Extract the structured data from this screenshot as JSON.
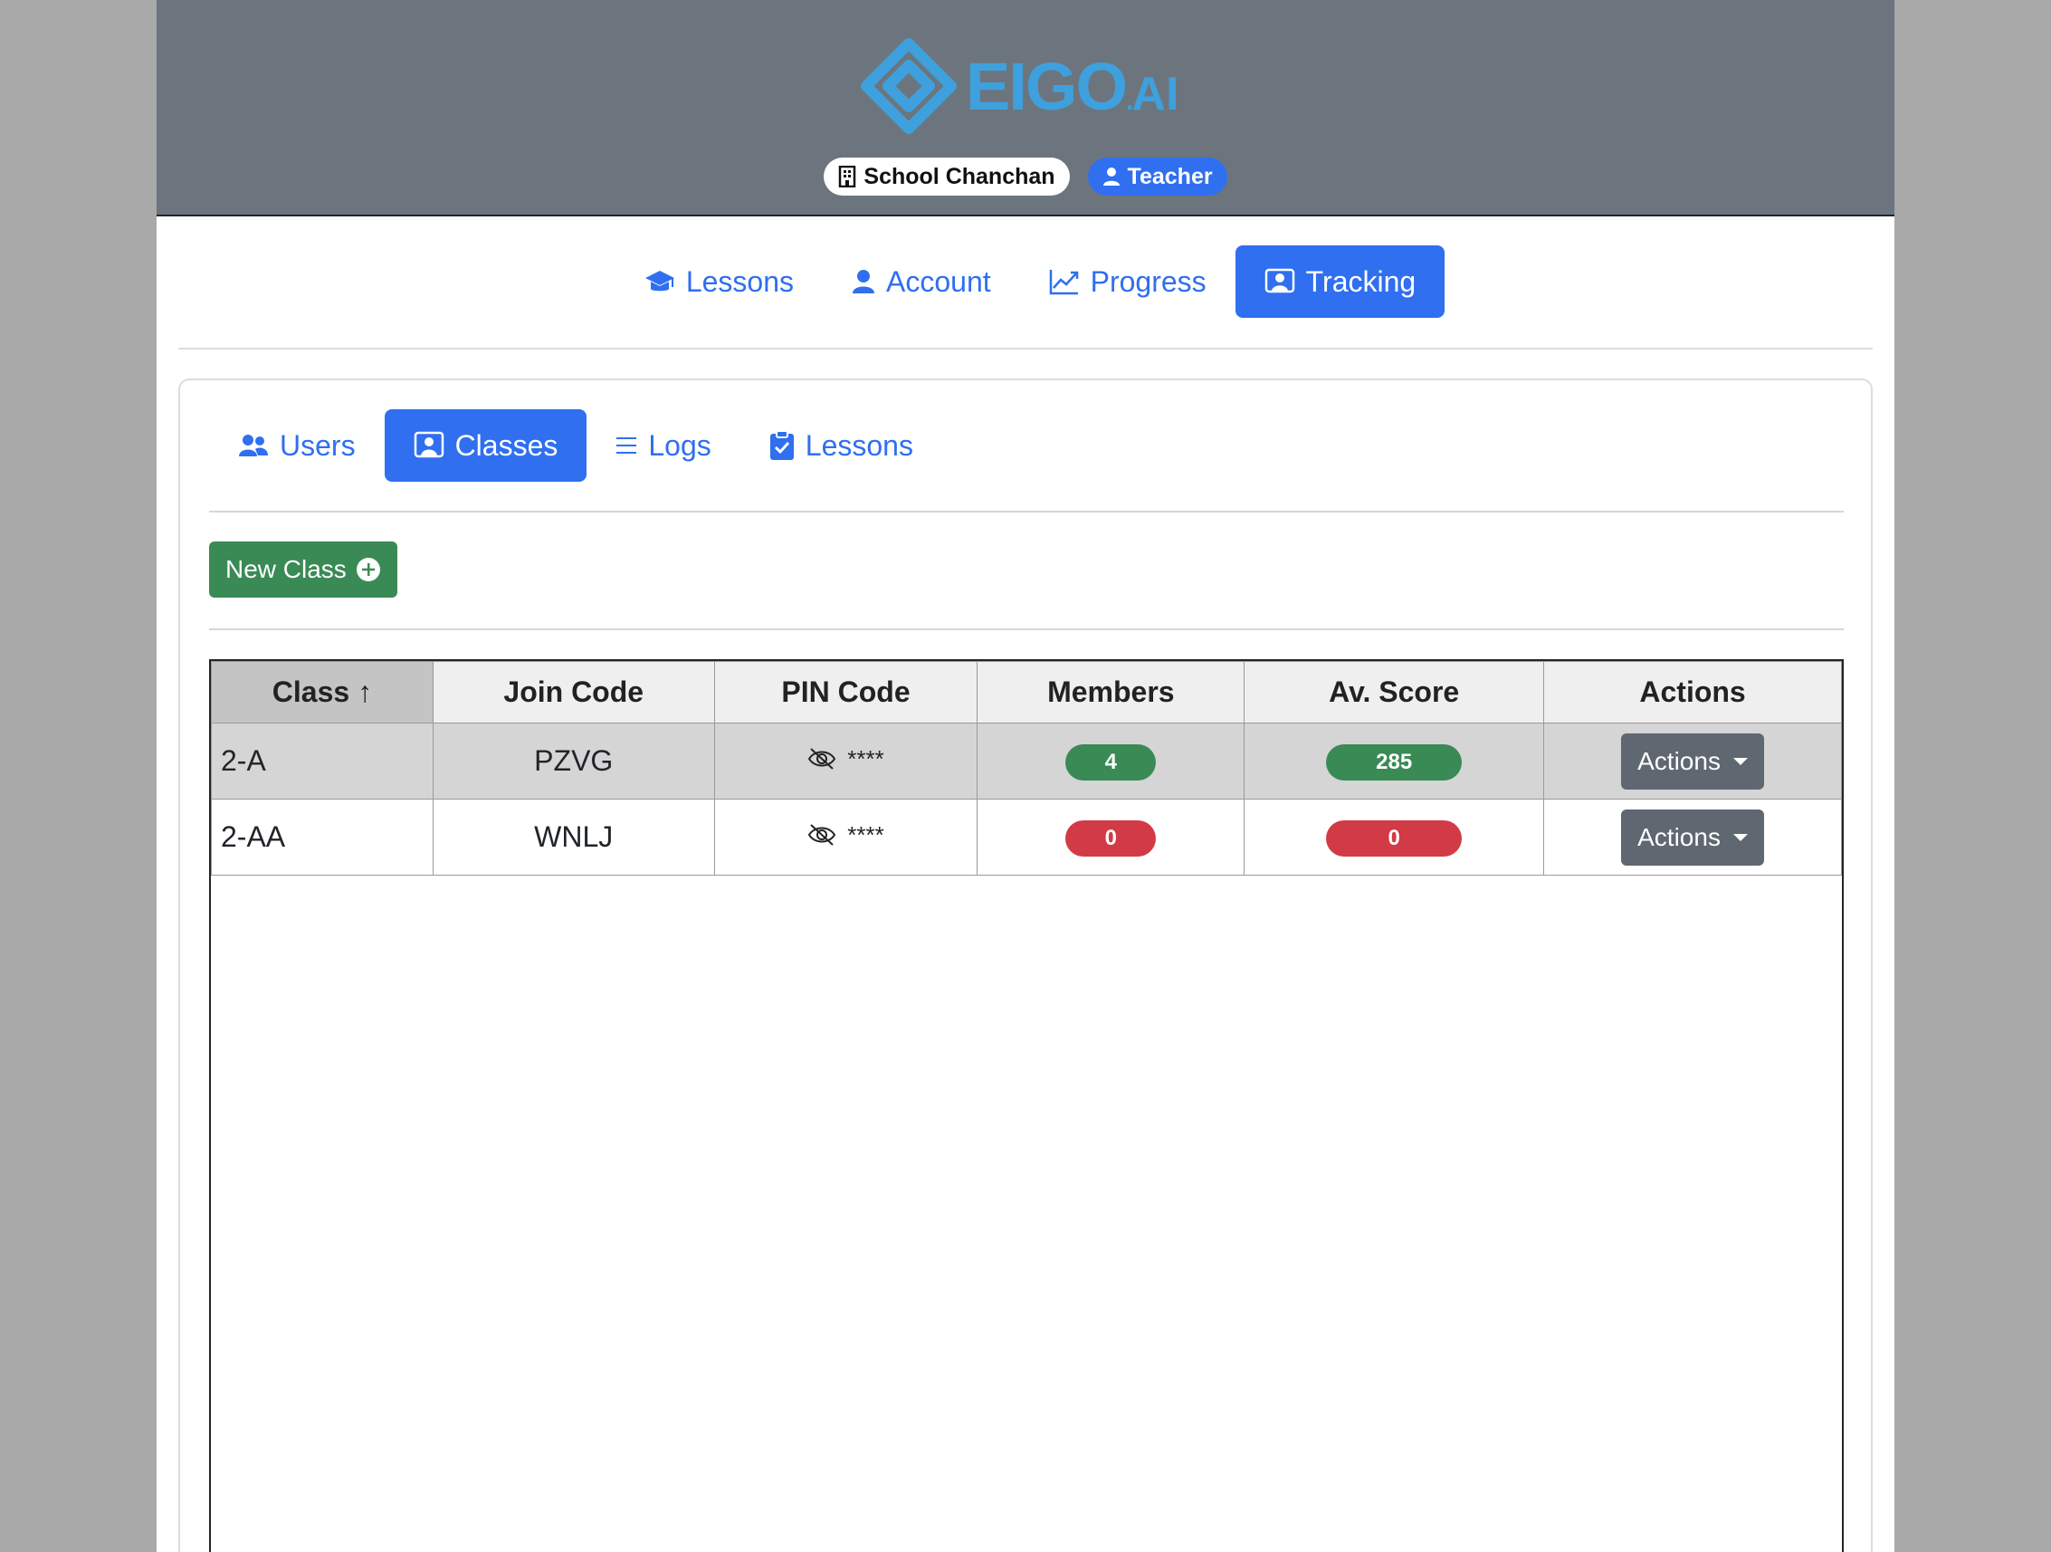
{
  "header": {
    "logo_main": "EIGO",
    "logo_dot": ".",
    "logo_suffix": "AI",
    "school_badge": "School Chanchan",
    "role_badge": "Teacher"
  },
  "main_nav": {
    "items": [
      {
        "label": "Lessons",
        "icon": "graduation-cap-icon"
      },
      {
        "label": "Account",
        "icon": "person-icon"
      },
      {
        "label": "Progress",
        "icon": "line-chart-icon"
      },
      {
        "label": "Tracking",
        "icon": "person-video-icon",
        "active": true
      }
    ]
  },
  "sub_nav": {
    "items": [
      {
        "label": "Users",
        "icon": "people-icon"
      },
      {
        "label": "Classes",
        "icon": "person-video-icon",
        "active": true
      },
      {
        "label": "Logs",
        "icon": "list-icon"
      },
      {
        "label": "Lessons",
        "icon": "clipboard-check-icon"
      }
    ]
  },
  "toolbar": {
    "new_class_label": "New Class"
  },
  "table": {
    "headers": {
      "class": "Class",
      "join_code": "Join Code",
      "pin_code": "PIN Code",
      "members": "Members",
      "av_score": "Av. Score",
      "actions": "Actions"
    },
    "sort_indicator": "↑",
    "rows": [
      {
        "class": "2-A",
        "join_code": "PZVG",
        "pin": "****",
        "members": "4",
        "av_score": "285",
        "actions_label": "Actions",
        "status_color": "#3a8a55"
      },
      {
        "class": "2-AA",
        "join_code": "WNLJ",
        "pin": "****",
        "members": "0",
        "av_score": "0",
        "actions_label": "Actions",
        "status_color": "#d23a45"
      }
    ]
  },
  "colors": {
    "primary": "#2f6ff0",
    "success": "#3a8a55",
    "danger": "#d23a45",
    "header_bg": "#6c757d",
    "secondary_button": "#5f6770"
  }
}
